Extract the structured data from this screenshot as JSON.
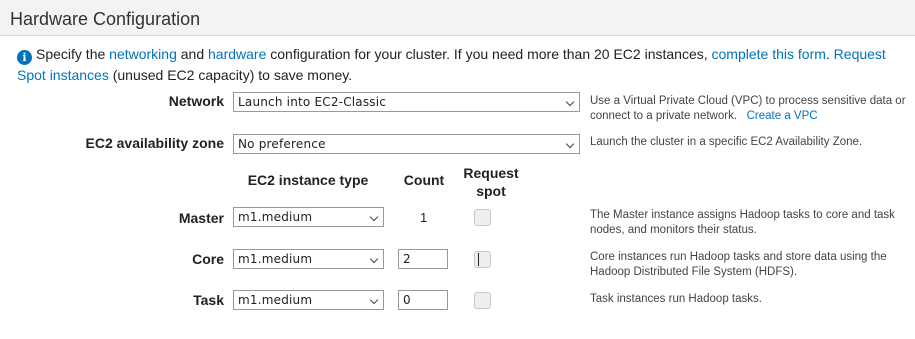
{
  "section": {
    "title": "Hardware Configuration"
  },
  "intro": {
    "text_1": "Specify the ",
    "link_networking": "networking",
    "text_2": " and ",
    "link_hardware": "hardware",
    "text_3": " configuration for your cluster. If you need more than 20 EC2 instances, ",
    "link_form": "complete this form",
    "text_4": ". ",
    "link_spot": "Request Spot instances",
    "text_5": " (unused EC2 capacity) to save money.",
    "icon": "info-icon"
  },
  "network": {
    "label": "Network",
    "value": "Launch into EC2-Classic",
    "help_1": "Use a Virtual Private Cloud (VPC) to process sensitive data or connect to a private network.",
    "help_link": "Create a VPC"
  },
  "zone": {
    "label": "EC2 availability zone",
    "value": "No preference",
    "help": "Launch the cluster in a specific EC2 Availability Zone."
  },
  "columns": {
    "instance_type": "EC2 instance type",
    "count": "Count",
    "request_spot": "Request spot"
  },
  "instances": [
    {
      "label": "Master",
      "type": "m1.medium",
      "count": "1",
      "count_editable": false,
      "spot": false,
      "help": "The Master instance assigns Hadoop tasks to core and task nodes, and monitors their status."
    },
    {
      "label": "Core",
      "type": "m1.medium",
      "count": "2",
      "count_editable": true,
      "spot": false,
      "help": "Core instances run Hadoop tasks and store data using the Hadoop Distributed File System (HDFS)."
    },
    {
      "label": "Task",
      "type": "m1.medium",
      "count": "0",
      "count_editable": true,
      "spot": false,
      "help": "Task instances run Hadoop tasks."
    }
  ],
  "colors": {
    "link": "#0073bb",
    "header_bg": "#f2f3f3",
    "border": "#999999"
  }
}
